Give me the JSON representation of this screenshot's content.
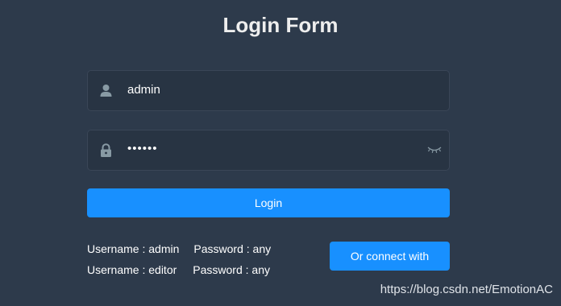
{
  "form": {
    "title": "Login Form",
    "username": {
      "value": "admin",
      "icon": "user-icon"
    },
    "password": {
      "value": "••••••",
      "icon": "lock-icon",
      "toggle_icon": "eye-closed-icon"
    },
    "login_label": "Login"
  },
  "tips": {
    "row1_user": "Username : admin",
    "row1_pass": "Password : any",
    "row2_user": "Username : editor",
    "row2_pass": "Password : any"
  },
  "connect_label": "Or connect with",
  "watermark": "https://blog.csdn.net/EmotionAC",
  "colors": {
    "background": "#2d3a4b",
    "input_bg": "#283443",
    "accent": "#1890ff",
    "text": "#eeeeee",
    "icon": "#889aa4"
  }
}
